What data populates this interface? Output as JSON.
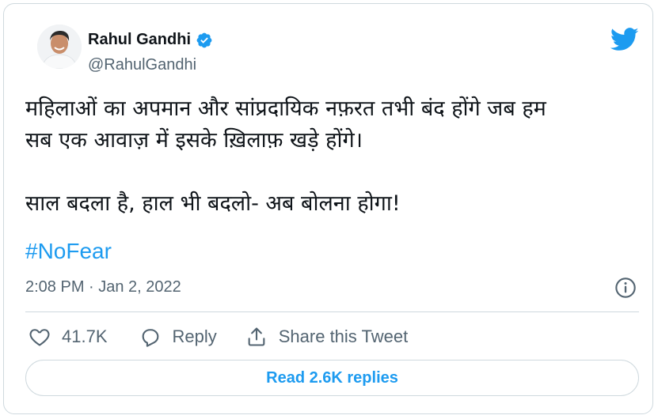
{
  "author": {
    "name": "Rahul Gandhi",
    "handle": "@RahulGandhi",
    "verified": true
  },
  "tweet": {
    "line1": "महिलाओं का अपमान और सांप्रदायिक नफ़रत तभी बंद होंगे जब हम",
    "line2": "सब एक आवाज़ में इसके ख़िलाफ़ खड़े होंगे।",
    "line3": "साल बदला है, हाल भी बदलो- अब बोलना होगा!",
    "hashtag": "#NoFear",
    "timestamp": "2:08 PM · Jan 2, 2022"
  },
  "actions": {
    "like_count": "41.7K",
    "reply_label": "Reply",
    "share_label": "Share this Tweet"
  },
  "read_replies_label": "Read 2.6K replies",
  "colors": {
    "accent": "#1d9bf0",
    "text": "#0f1419",
    "secondary": "#536471",
    "border": "#cfd9de"
  },
  "icons": [
    "verified-badge-icon",
    "twitter-bird-icon",
    "info-icon",
    "heart-icon",
    "reply-icon",
    "share-icon"
  ]
}
